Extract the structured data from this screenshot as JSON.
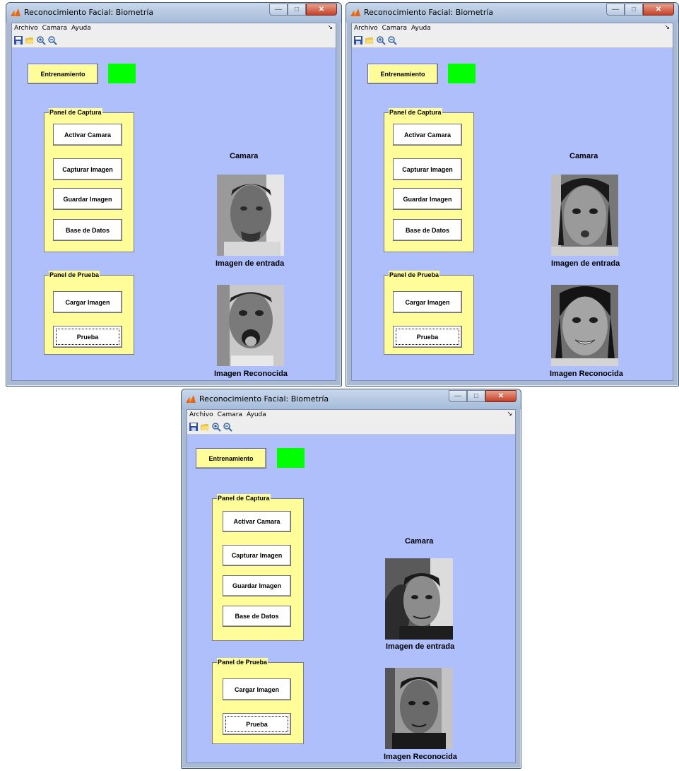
{
  "windows": [
    {
      "title": "Reconocimiento Facial: Biometría",
      "menu": [
        "Archivo",
        "Camara",
        "Ayuda"
      ],
      "buttons": {
        "train": "Entrenamiento",
        "activate": "Activar Camara",
        "capture": "Capturar Imagen",
        "save": "Guardar  Imagen",
        "database": "Base de Datos",
        "load": "Cargar Imagen",
        "test": "Prueba"
      },
      "panels": {
        "capture": "Panel de Captura",
        "test": "Panel de Prueba"
      },
      "labels": {
        "camera": "Camara",
        "input": "Imagen de entrada",
        "recognized": "Imagen Reconocida"
      }
    },
    {
      "title": "Reconocimiento Facial: Biometría",
      "menu": [
        "Archivo",
        "Camara",
        "Ayuda"
      ],
      "buttons": {
        "train": "Entrenamiento",
        "activate": "Activar Camara",
        "capture": "Capturar Imagen",
        "save": "Guardar  Imagen",
        "database": "Base de Datos",
        "load": "Cargar Imagen",
        "test": "Prueba"
      },
      "panels": {
        "capture": "Panel de Captura",
        "test": "Panel de Prueba"
      },
      "labels": {
        "camera": "Camara",
        "input": "Imagen de entrada",
        "recognized": "Imagen Reconocida"
      }
    },
    {
      "title": "Reconocimiento Facial: Biometría",
      "menu": [
        "Archivo",
        "Camara",
        "Ayuda"
      ],
      "buttons": {
        "train": "Entrenamiento",
        "activate": "Activar Camara",
        "capture": "Capturar Imagen",
        "save": "Guardar  Imagen",
        "database": "Base de Datos",
        "load": "Cargar Imagen",
        "test": "Prueba"
      },
      "panels": {
        "capture": "Panel de Captura",
        "test": "Panel de Prueba"
      },
      "labels": {
        "camera": "Camara",
        "input": "Imagen de entrada",
        "recognized": "Imagen Reconocida"
      }
    }
  ],
  "colors": {
    "background": "#aebffc",
    "panel": "#fffc9a",
    "indicator": "#00ff00"
  }
}
